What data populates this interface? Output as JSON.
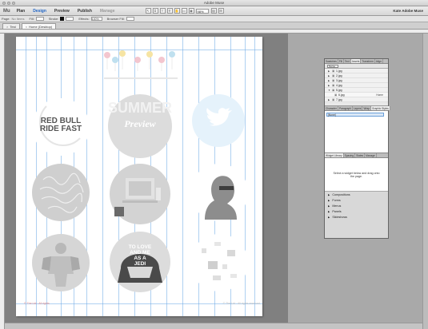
{
  "window": {
    "title": "Adobe Muse"
  },
  "menubar": {
    "logo": "Mu",
    "items": [
      {
        "label": "Plan",
        "state": "normal"
      },
      {
        "label": "Design",
        "state": "active"
      },
      {
        "label": "Preview",
        "state": "normal"
      },
      {
        "label": "Publish",
        "state": "normal"
      },
      {
        "label": "Manage",
        "state": "disabled"
      }
    ],
    "zoom": "98%",
    "user": "Kate Adobe Muse"
  },
  "options": {
    "page_label": "Page:",
    "page_value": "No Items",
    "fill_label": "Fill:",
    "stroke_label": "Stroke:",
    "effects_label": "Effects:",
    "effects_value": "100%",
    "browser_fill_label": "Browser Fill:"
  },
  "tabs": [
    {
      "label": "Test",
      "state": "normal"
    },
    {
      "label": "Home (Desktop)",
      "state": "active"
    }
  ],
  "artboard": {
    "footer_left": "© The Ltd · All rights",
    "footer_right": "© The Ltd · All rights reserved",
    "tiles": [
      {
        "name": "red-bull-tile",
        "line1": "RED BULL",
        "line2": "RIDE FAST"
      },
      {
        "name": "summer-tile",
        "line1": "SUMMER",
        "line2": "Preview"
      },
      {
        "name": "twitter-tile"
      },
      {
        "name": "typography-tile"
      },
      {
        "name": "desk-tile"
      },
      {
        "name": "portrait-tile"
      },
      {
        "name": "robot-tile"
      },
      {
        "name": "darth-tile",
        "line1": "TO LOVE",
        "line2": "AND ME",
        "line3": "AS A",
        "line4": "JEDI"
      },
      {
        "name": "pattern-tile"
      }
    ]
  },
  "panel": {
    "top_tabs": [
      "Swatches",
      "Fill",
      "Text",
      "Assets",
      "Transform",
      "Align"
    ],
    "filter": "Name",
    "assets": [
      {
        "name": "1.jpg",
        "state": ""
      },
      {
        "name": "2.jpg",
        "state": ""
      },
      {
        "name": "3.jpg",
        "state": ""
      },
      {
        "name": "4.jpg",
        "state": ""
      },
      {
        "name": "5.jpg",
        "state": ""
      },
      {
        "name": "6.jpg",
        "state": "Home"
      },
      {
        "name": "7.jpg",
        "state": ""
      }
    ],
    "mid_tabs": [
      "Character",
      "Paragraph",
      "Layers",
      "Wrap",
      "Graphic Styles"
    ],
    "states_input": "[None]",
    "lower_tabs": [
      "Widget Library",
      "Spacing",
      "States",
      "Manage"
    ],
    "widget_hint": "Select a widget below and drag onto the page.",
    "categories": [
      "Compositions",
      "Forms",
      "Menus",
      "Panels",
      "Slideshows"
    ]
  }
}
